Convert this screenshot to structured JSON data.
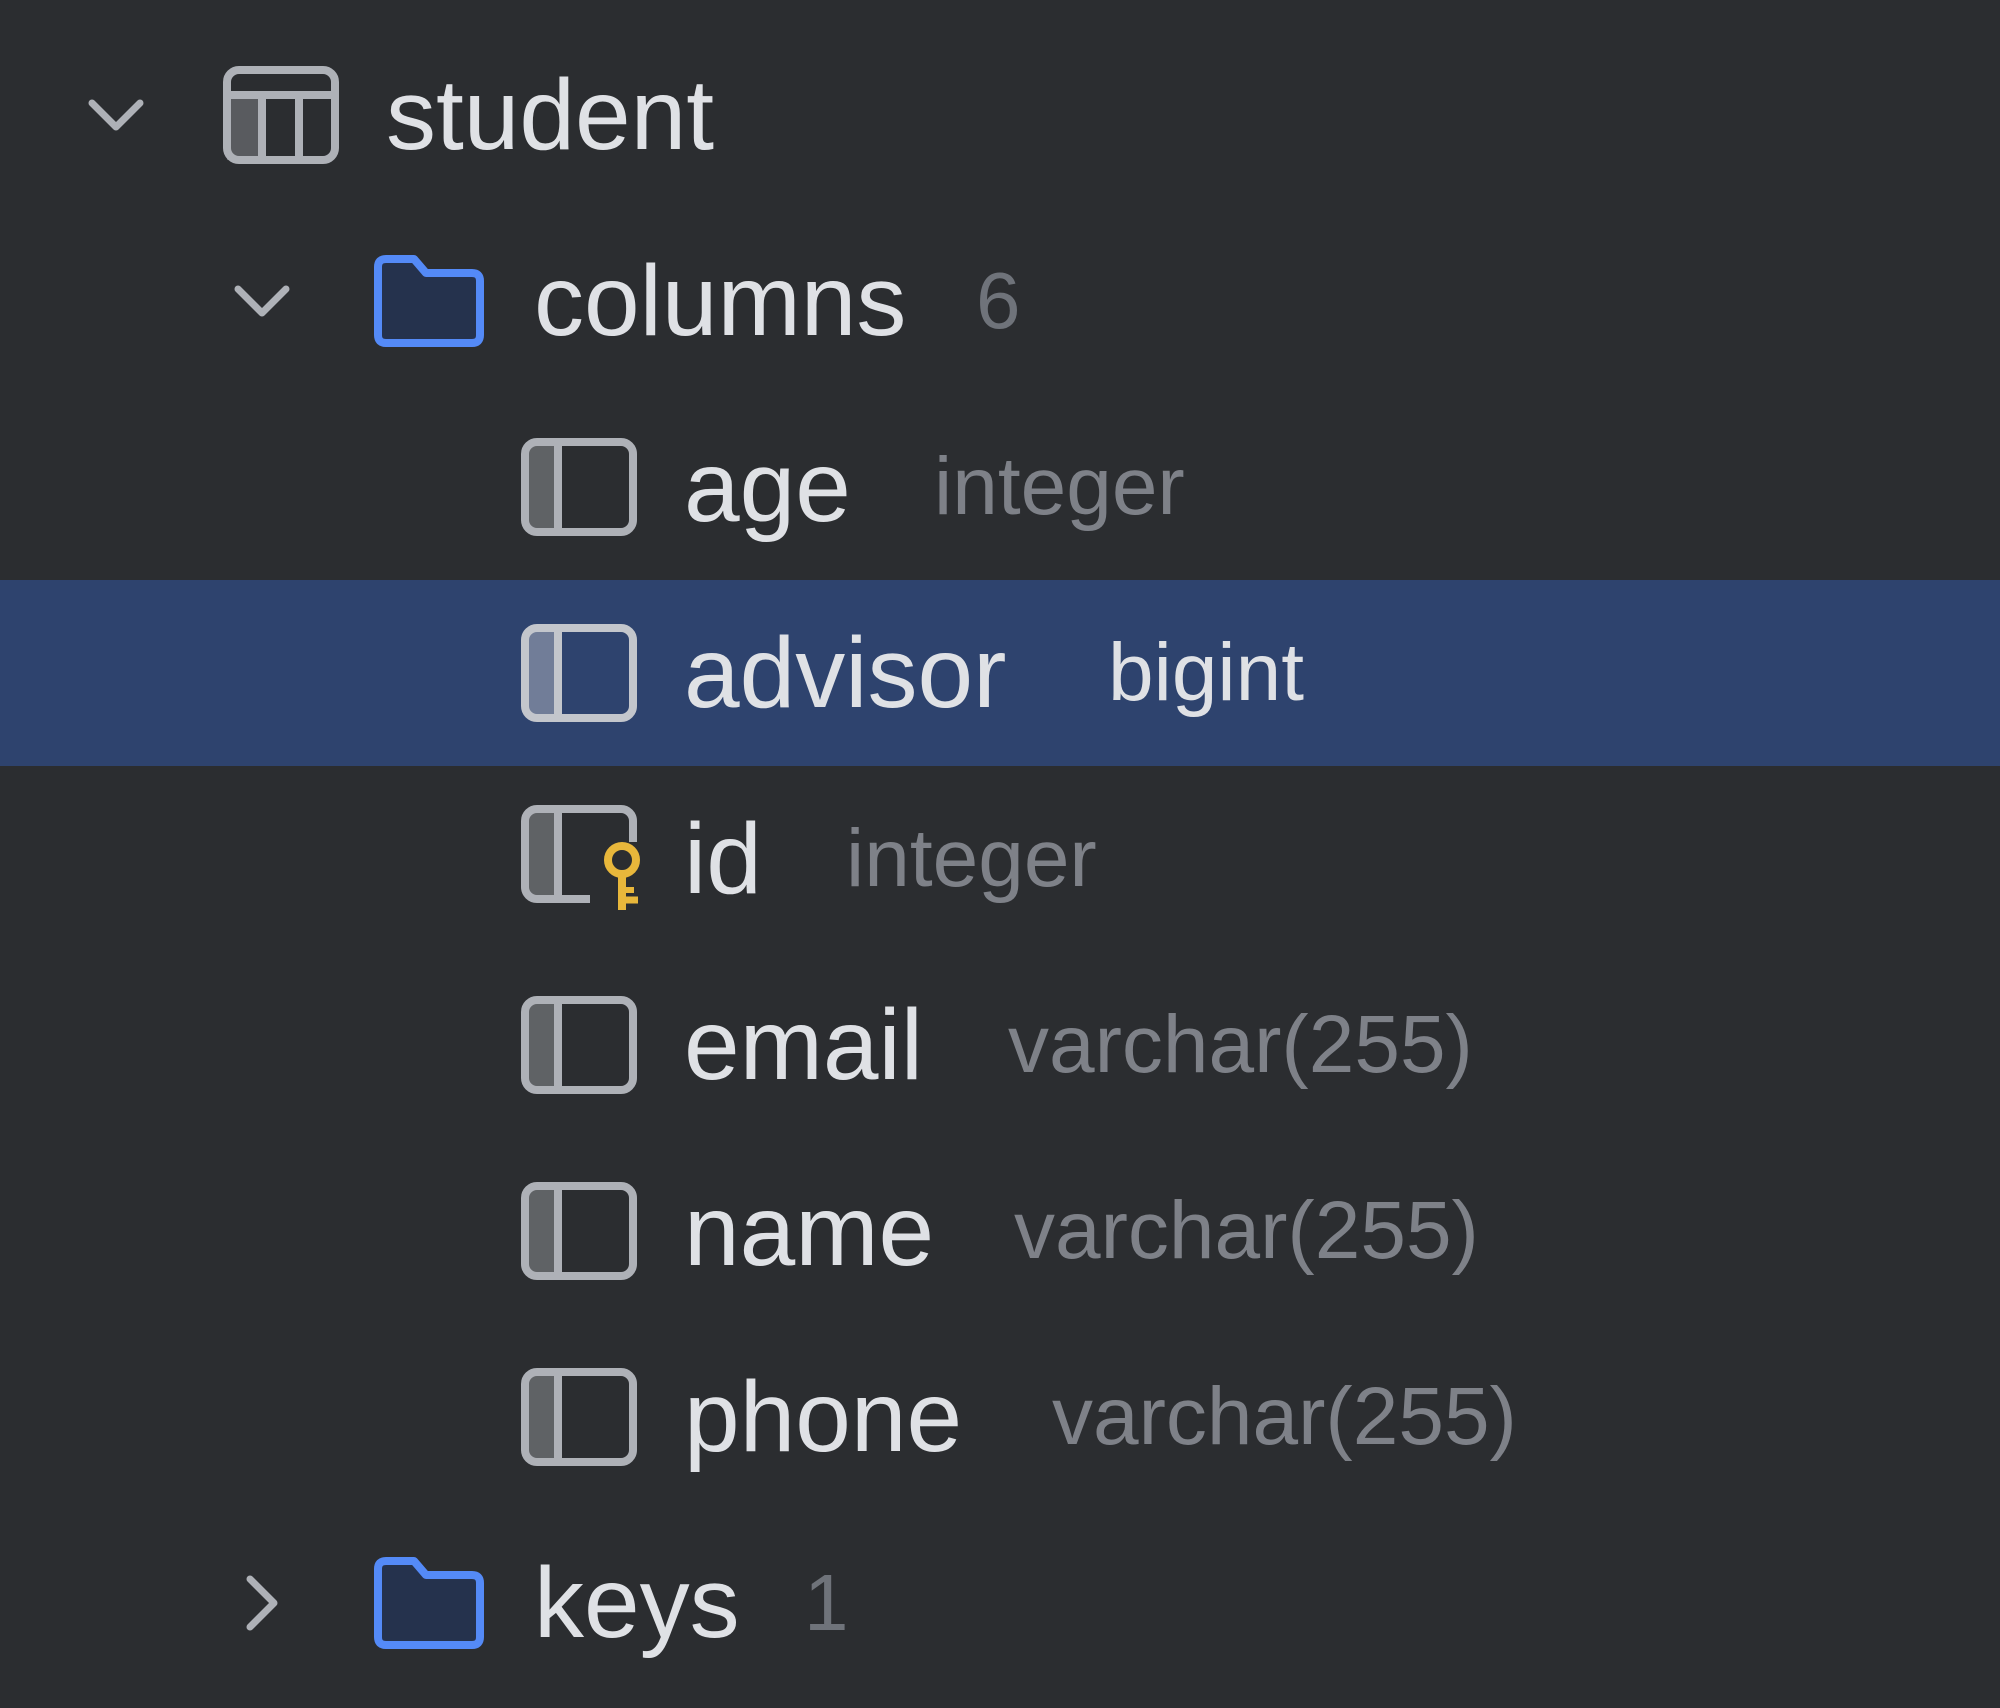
{
  "colors": {
    "background": "#2b2d30",
    "selection": "#2e436e",
    "text": "#dfe1e5",
    "muted": "#7e8188",
    "folder_blue": "#548af7",
    "key_gold": "#e8b73b"
  },
  "table": {
    "name": "student",
    "icon": "table-icon",
    "expanded": true
  },
  "columns_folder": {
    "label": "columns",
    "count": "6",
    "icon": "folder-icon",
    "expanded": true
  },
  "columns": [
    {
      "name": "age",
      "type": "integer",
      "icon": "column-icon",
      "selected": false
    },
    {
      "name": "advisor",
      "type": "bigint",
      "icon": "column-icon",
      "selected": true
    },
    {
      "name": "id",
      "type": "integer",
      "icon": "primary-key-column-icon",
      "selected": false
    },
    {
      "name": "email",
      "type": "varchar(255)",
      "icon": "column-icon",
      "selected": false
    },
    {
      "name": "name",
      "type": "varchar(255)",
      "icon": "column-icon",
      "selected": false
    },
    {
      "name": "phone",
      "type": "varchar(255)",
      "icon": "column-icon",
      "selected": false
    }
  ],
  "keys_folder": {
    "label": "keys",
    "count": "1",
    "icon": "folder-icon",
    "expanded": false
  }
}
